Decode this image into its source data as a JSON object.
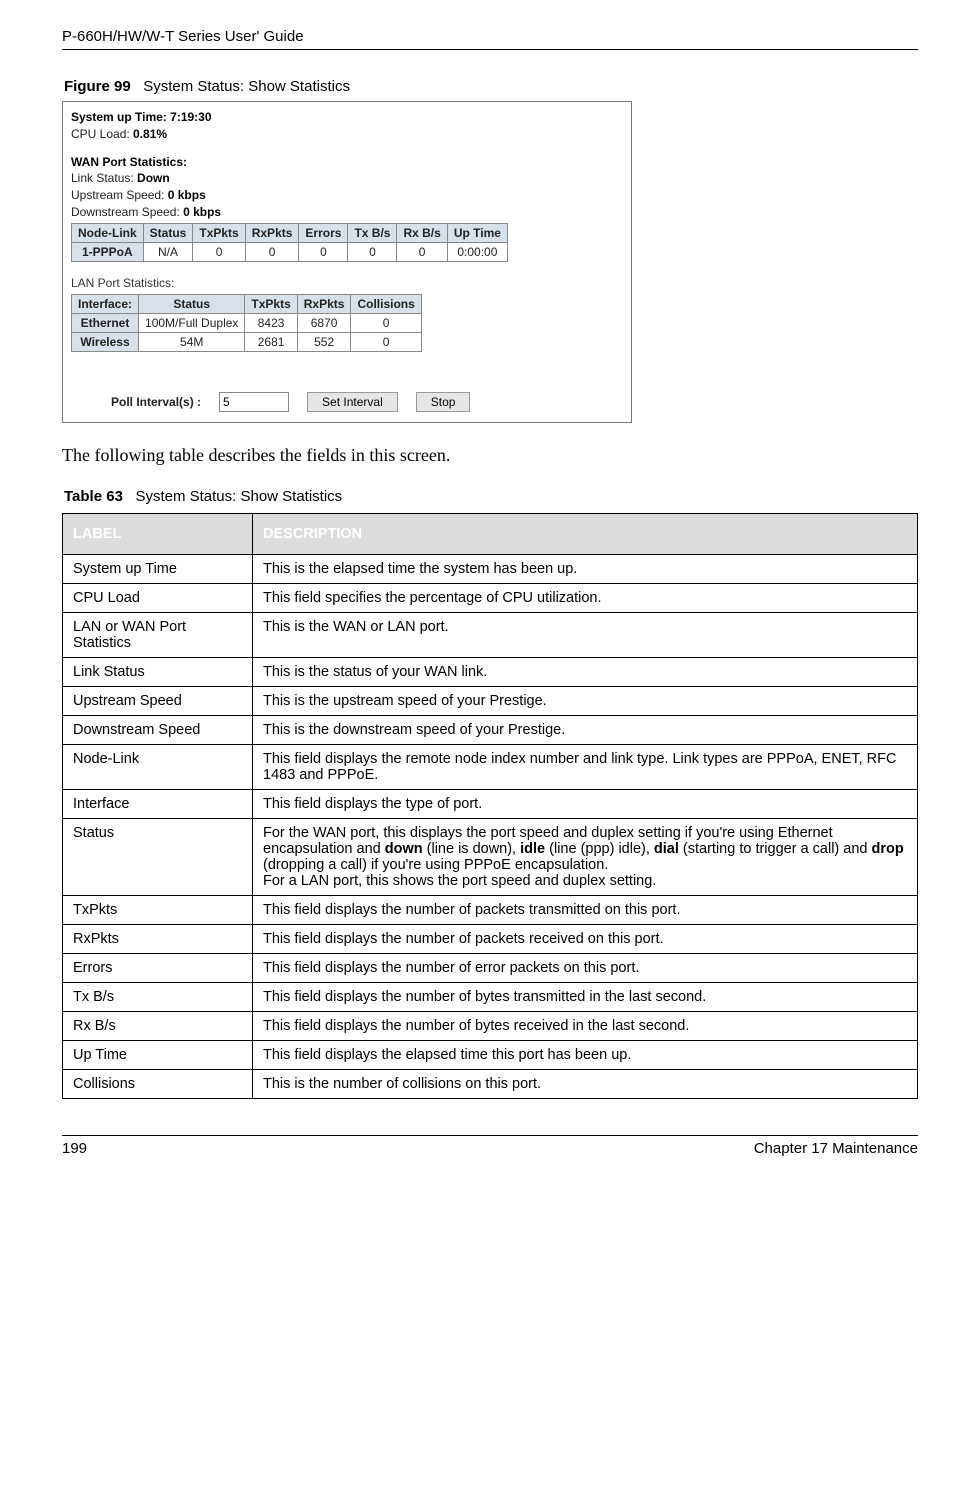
{
  "header": {
    "running": "P-660H/HW/W-T Series User' Guide"
  },
  "figure": {
    "label": "Figure 99",
    "title": "System Status: Show Statistics"
  },
  "screenshot": {
    "uptime_label": "System up Time:",
    "uptime_value": "7:19:30",
    "cpu_label": "CPU Load:",
    "cpu_value": "0.81%",
    "wan_section": "WAN Port Statistics:",
    "link_status_label": "Link Status:",
    "link_status_value": "Down",
    "up_speed_label": "Upstream Speed:",
    "up_speed_value": "0 kbps",
    "down_speed_label": "Downstream Speed:",
    "down_speed_value": "0 kbps",
    "wan_headers": [
      "Node-Link",
      "Status",
      "TxPkts",
      "RxPkts",
      "Errors",
      "Tx B/s",
      "Rx B/s",
      "Up Time"
    ],
    "wan_row": [
      "1-PPPoA",
      "N/A",
      "0",
      "0",
      "0",
      "0",
      "0",
      "0:00:00"
    ],
    "lan_section": "LAN Port Statistics:",
    "lan_headers": [
      "Interface:",
      "Status",
      "TxPkts",
      "RxPkts",
      "Collisions"
    ],
    "lan_rows": [
      [
        "Ethernet",
        "100M/Full Duplex",
        "8423",
        "6870",
        "0"
      ],
      [
        "Wireless",
        "54M",
        "2681",
        "552",
        "0"
      ]
    ],
    "poll_label": "Poll Interval(s) :",
    "poll_value": "5",
    "btn_set": "Set Interval",
    "btn_stop": "Stop"
  },
  "para": "The following table describes the fields in this screen.",
  "table_caption": {
    "label": "Table 63",
    "title": "System Status: Show Statistics"
  },
  "desc_headers": {
    "c1": "LABEL",
    "c2": "DESCRIPTION"
  },
  "rows": [
    {
      "l": "System up Time",
      "d": "This is the elapsed time the system has been up."
    },
    {
      "l": "CPU Load",
      "d": "This field specifies the percentage of CPU utilization."
    },
    {
      "l": "LAN or WAN Port Statistics",
      "d": "This is the WAN or LAN port."
    },
    {
      "l": "Link Status",
      "d": "This is the status of your WAN link."
    },
    {
      "l": "Upstream Speed",
      "d": "This is the upstream speed of your Prestige."
    },
    {
      "l": "Downstream Speed",
      "d": "This is the downstream speed of your Prestige."
    },
    {
      "l": "Node-Link",
      "d": "This field displays the remote node index number and link type. Link types are PPPoA, ENET, RFC 1483 and PPPoE."
    },
    {
      "l": "Interface",
      "d": "This field displays the type of port."
    },
    {
      "l": "Status",
      "d1": "For the WAN port, this displays the port speed and duplex setting if you're using Ethernet encapsulation and ",
      "b1": "down",
      "d2": " (line is down), ",
      "b2": "idle",
      "d3": " (line (ppp) idle), ",
      "b3": "dial",
      "d4": " (starting to trigger a call) and ",
      "b4": "drop",
      "d5": " (dropping a call) if you're using PPPoE encapsulation.",
      "d6": "For a LAN port, this shows the port speed and duplex setting."
    },
    {
      "l": "TxPkts",
      "d": "This field displays the number of packets transmitted on this port."
    },
    {
      "l": "RxPkts",
      "d": "This field displays the number of packets received on this port."
    },
    {
      "l": "Errors",
      "d": "This field displays the number of error packets on this port."
    },
    {
      "l": "Tx B/s",
      "d": "This field displays the number of bytes transmitted in the last second."
    },
    {
      "l": "Rx B/s",
      "d": "This field displays the number of bytes received in the last second."
    },
    {
      "l": "Up Time",
      "d": "This field displays the elapsed time this port has been up."
    },
    {
      "l": "Collisions",
      "d": "This is the number of collisions on this port."
    }
  ],
  "footer": {
    "page": "199",
    "chapter": "Chapter 17 Maintenance"
  }
}
